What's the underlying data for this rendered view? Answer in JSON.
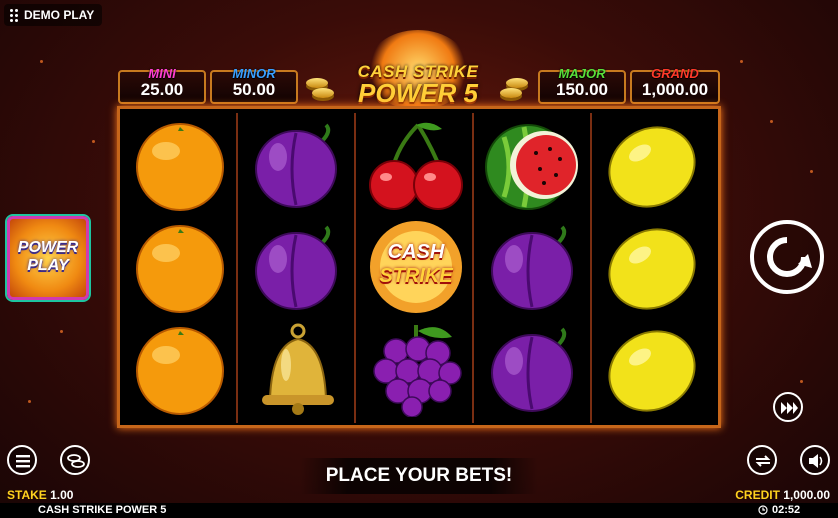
{
  "demo_badge": {
    "label": "DEMO PLAY"
  },
  "jackpots": [
    {
      "name": "MINI",
      "value": "25.00",
      "color": "#ff3fd0"
    },
    {
      "name": "MINOR",
      "value": "50.00",
      "color": "#3aa0ff"
    },
    {
      "name": "MAJOR",
      "value": "150.00",
      "color": "#5adf3a"
    },
    {
      "name": "GRAND",
      "value": "1,000.00",
      "color": "#ff3a2a"
    }
  ],
  "logo": {
    "line1": "CASH STRIKE",
    "line2": "POWER 5"
  },
  "reels": [
    [
      "orange",
      "orange",
      "orange"
    ],
    [
      "plum",
      "plum",
      "bell"
    ],
    [
      "cherries",
      "cash-strike",
      "grapes"
    ],
    [
      "watermelon",
      "plum",
      "plum"
    ],
    [
      "lemon",
      "lemon",
      "lemon"
    ]
  ],
  "cash_strike_symbol": {
    "line1": "CASH",
    "line2": "STRIKE"
  },
  "power_play": {
    "line1": "POWER",
    "line2": "PLAY"
  },
  "message": "PLACE YOUR BETS!",
  "stake": {
    "label": "STAKE",
    "value": "1.00"
  },
  "credit": {
    "label": "CREDIT",
    "value": "1,000.00"
  },
  "game_name": "CASH STRIKE POWER 5",
  "clock": "02:52"
}
